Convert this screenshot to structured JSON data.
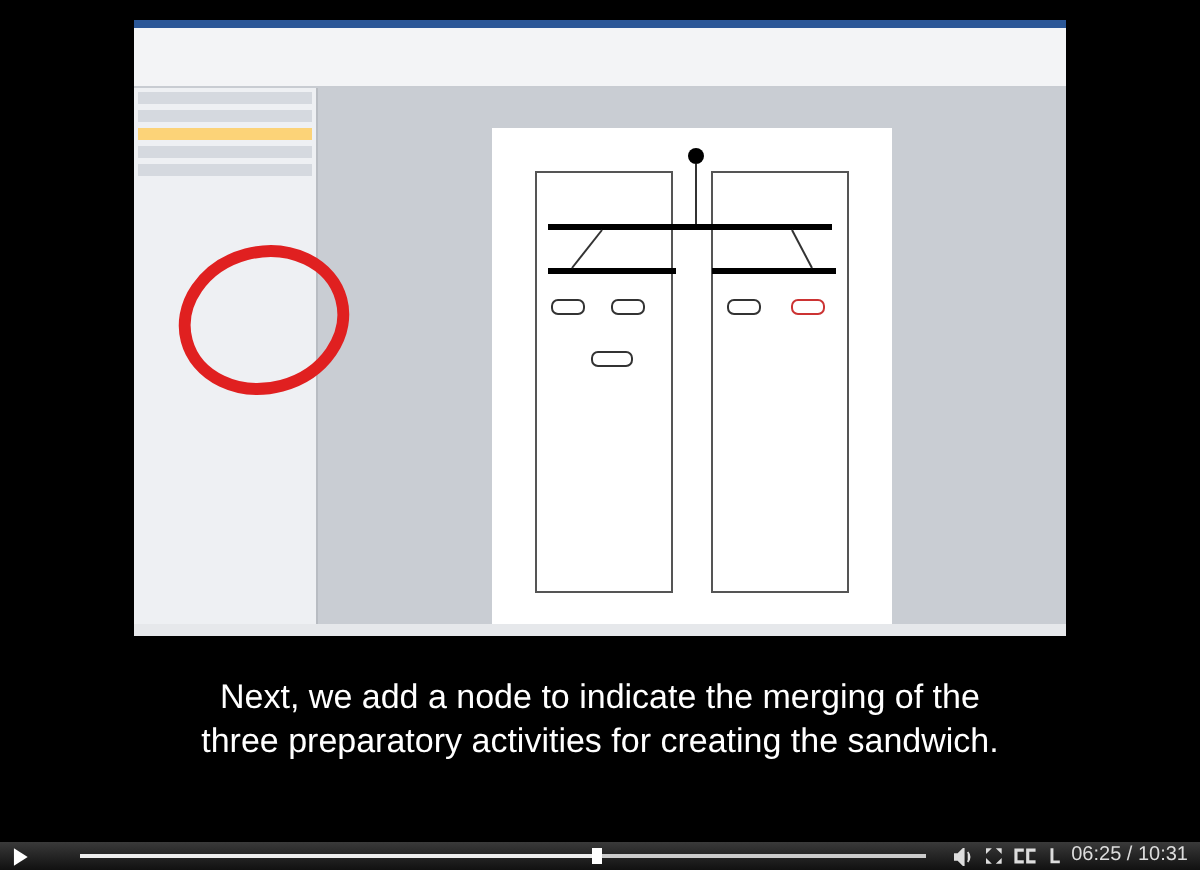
{
  "caption": {
    "lines": [
      "Next, we add a node to indicate the merging of the",
      "three preparatory activities for creating the sandwich."
    ]
  },
  "player": {
    "progress": {
      "level": 0.61
    },
    "time": "06:25 / 10:31"
  }
}
